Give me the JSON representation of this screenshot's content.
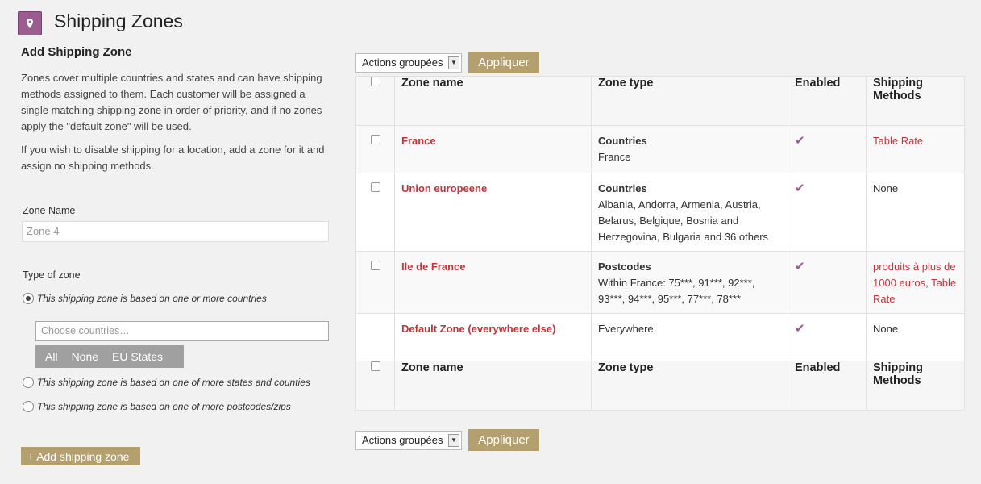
{
  "header": {
    "title": "Shipping Zones",
    "icon": "map-pin-icon"
  },
  "add_zone": {
    "heading": "Add Shipping Zone",
    "description_1": "Zones cover multiple countries and states and can have shipping methods assigned to them. Each customer will be assigned a single matching shipping zone in order of priority, and if no zones apply the \"default zone\" will be used.",
    "description_2": "If you wish to disable shipping for a location, add a zone for it and assign no shipping methods.",
    "zone_name_label": "Zone Name",
    "zone_name_placeholder": "Zone 4",
    "type_label": "Type of zone",
    "types": [
      {
        "label": "This shipping zone is based on one or more countries",
        "selected": true
      },
      {
        "label": "This shipping zone is based on one of more states and counties",
        "selected": false
      },
      {
        "label": "This shipping zone is based on one of more postcodes/zips",
        "selected": false
      }
    ],
    "countries_placeholder": "Choose countries…",
    "quick_buttons": [
      "All",
      "None",
      "EU States"
    ],
    "add_button": "Add shipping zone"
  },
  "bulk": {
    "select_label": "Actions groupées",
    "apply_label": "Appliquer"
  },
  "table": {
    "headers": {
      "zone_name": "Zone name",
      "zone_type": "Zone type",
      "enabled": "Enabled",
      "methods": "Shipping Methods"
    },
    "rows": [
      {
        "name": "France",
        "type_title": "Countries",
        "type_detail": "France",
        "enabled": true,
        "methods": "Table Rate",
        "methods_link": true,
        "checkbox": true
      },
      {
        "name": "Union europeene",
        "type_title": "Countries",
        "type_detail": "Albania, Andorra, Armenia, Austria, Belarus, Belgique, Bosnia and Herzegovina, Bulgaria and 36 others",
        "enabled": true,
        "methods": "None",
        "methods_link": false,
        "checkbox": true
      },
      {
        "name": "Ile de France",
        "type_title": "Postcodes",
        "type_detail": "Within France: 75***, 91***, 92***, 93***, 94***, 95***, 77***, 78***",
        "enabled": true,
        "methods": "produits à plus de 1000 euros",
        "methods_extra": "Table Rate",
        "methods_link": true,
        "checkbox": true
      },
      {
        "name": "Default Zone (everywhere else)",
        "type_title": "",
        "type_detail": "Everywhere",
        "enabled": true,
        "methods": "None",
        "methods_link": false,
        "checkbox": false
      }
    ]
  },
  "colors": {
    "accent": "#b3a06e",
    "link": "#c3363a",
    "icon": "#9b5c8f"
  }
}
